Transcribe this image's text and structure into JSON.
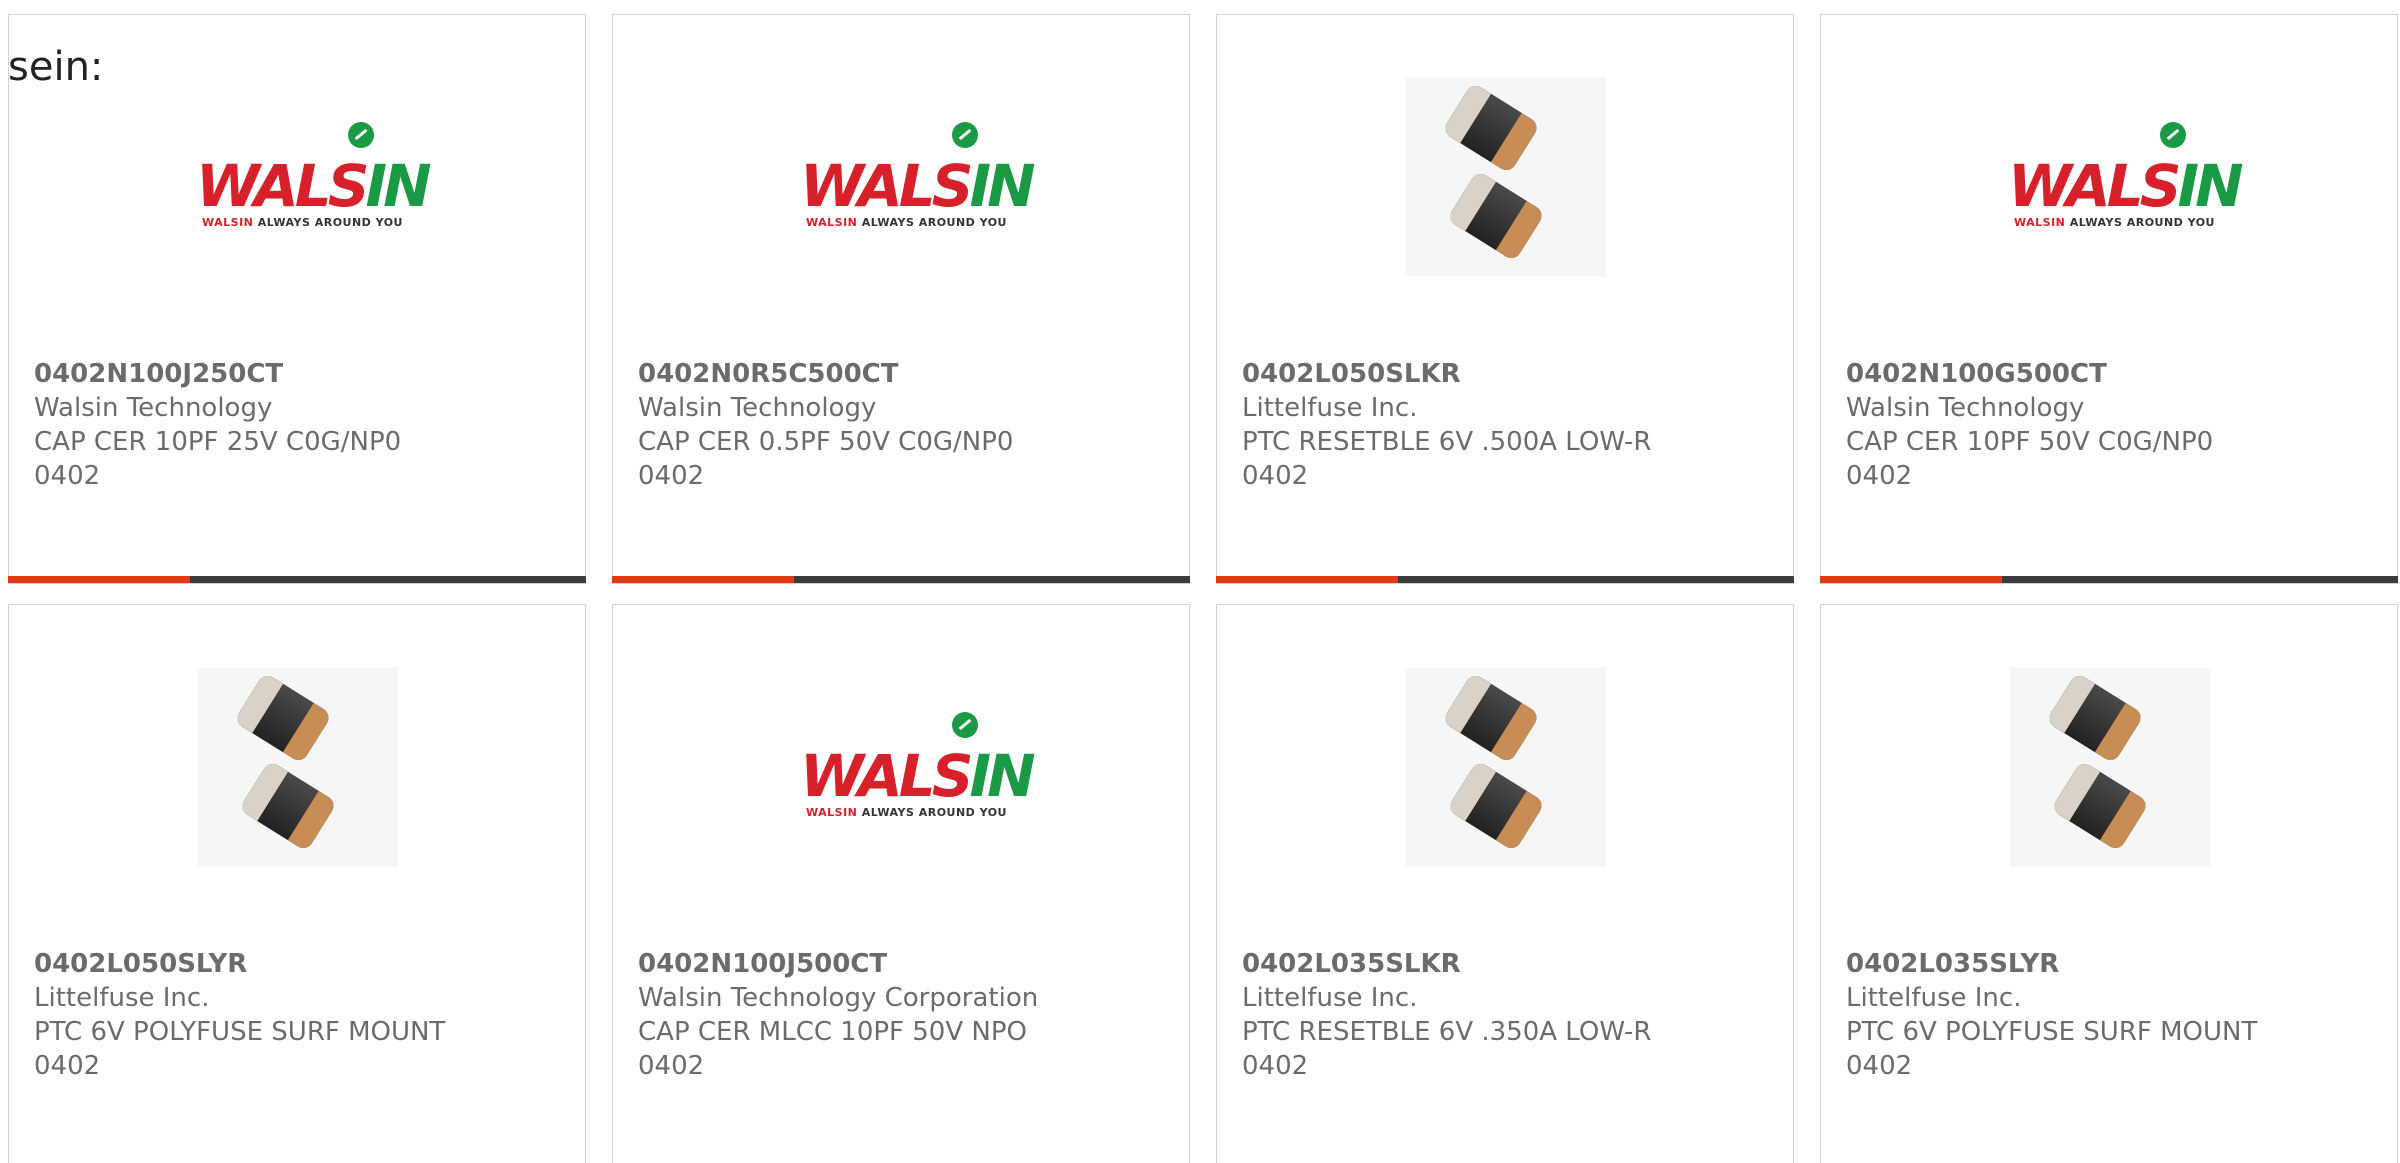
{
  "intro_text": "sein:",
  "logo_text": {
    "wordmark_red": "WALS",
    "wordmark_green": "IN",
    "tagline_brand": "WALSIN",
    "tagline_rest": "ALWAYS AROUND YOU"
  },
  "colors": {
    "accent": "#e03a12",
    "bar": "#3c3c3c",
    "text": "#6b6b6b",
    "walsin_red": "#d6202a",
    "walsin_green": "#1a9a45"
  },
  "products": [
    {
      "part": "0402N100J250CT",
      "maker": "Walsin Technology",
      "desc": "CAP CER 10PF 25V C0G/NP0",
      "package": "0402",
      "image": "walsin-logo"
    },
    {
      "part": "0402N0R5C500CT",
      "maker": "Walsin Technology",
      "desc": "CAP CER 0.5PF 50V C0G/NP0",
      "package": "0402",
      "image": "walsin-logo"
    },
    {
      "part": "0402L050SLKR",
      "maker": "Littelfuse Inc.",
      "desc": "PTC RESETBLE 6V .500A LOW-R",
      "package": "0402",
      "image": "smd-chip-photo"
    },
    {
      "part": "0402N100G500CT",
      "maker": "Walsin Technology",
      "desc": "CAP CER 10PF 50V C0G/NP0",
      "package": "0402",
      "image": "walsin-logo"
    },
    {
      "part": "0402L050SLYR",
      "maker": "Littelfuse Inc.",
      "desc": "PTC 6V POLYFUSE SURF MOUNT",
      "package": "0402",
      "image": "smd-chip-photo"
    },
    {
      "part": "0402N100J500CT",
      "maker": "Walsin Technology Corporation",
      "desc": "CAP CER MLCC 10PF 50V NPO",
      "package": "0402",
      "image": "walsin-logo"
    },
    {
      "part": "0402L035SLKR",
      "maker": "Littelfuse Inc.",
      "desc": "PTC RESETBLE 6V .350A LOW-R",
      "package": "0402",
      "image": "smd-chip-photo"
    },
    {
      "part": "0402L035SLYR",
      "maker": "Littelfuse Inc.",
      "desc": "PTC 6V POLYFUSE SURF MOUNT",
      "package": "0402",
      "image": "smd-chip-photo"
    }
  ]
}
